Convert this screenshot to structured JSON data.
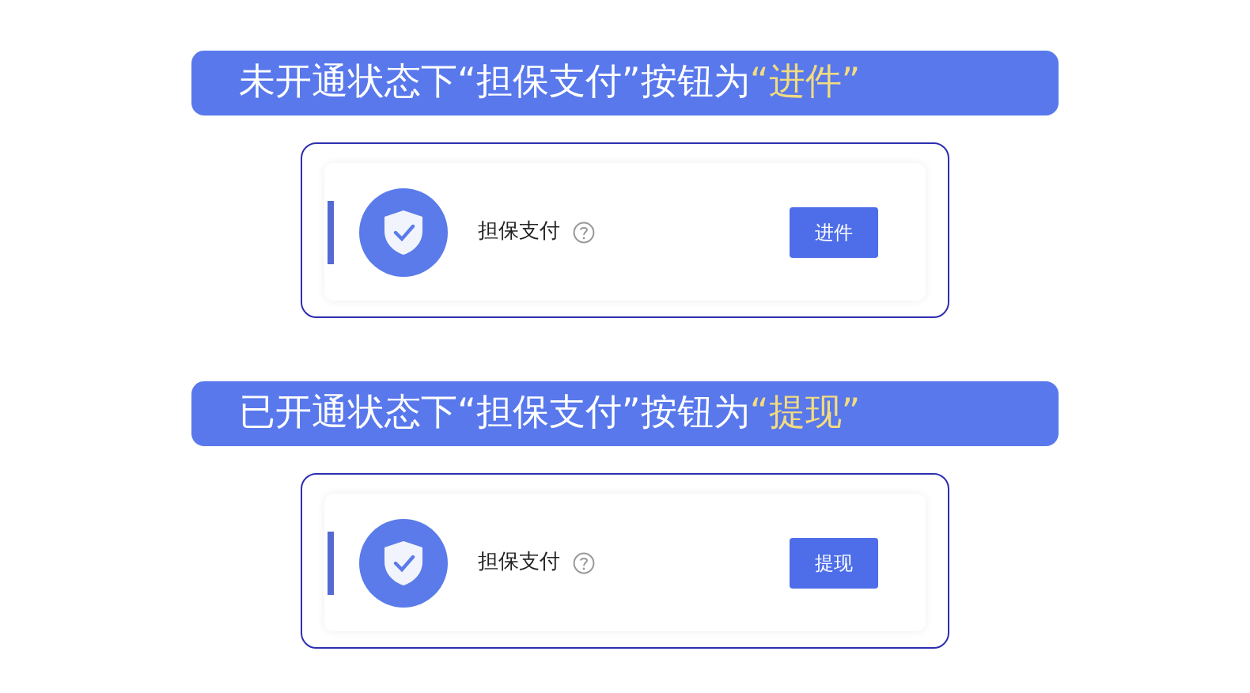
{
  "sections": [
    {
      "caption": "未开通状态下“担保支付”按钮为",
      "highlight": "“进件”",
      "item": {
        "label": "担保支付",
        "button": "进件"
      }
    },
    {
      "caption": "已开通状态下“担保支付”按钮为",
      "highlight": "“提现”",
      "item": {
        "label": "担保支付",
        "button": "提现"
      }
    }
  ]
}
